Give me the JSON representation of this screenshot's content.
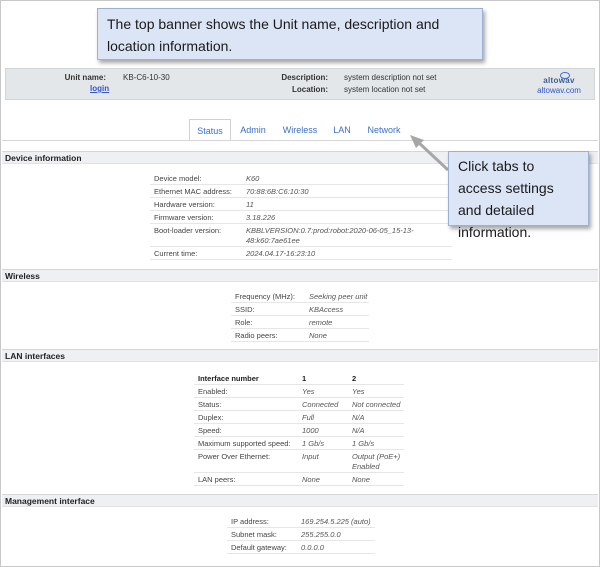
{
  "callouts": {
    "top": "The top banner shows the Unit name, description and location information.",
    "right": "Click tabs to access settings and detailed information."
  },
  "header": {
    "unit_name_label": "Unit name:",
    "unit_name_value": "KB-C6-10-30",
    "login_label": "login",
    "description_label": "Description:",
    "description_value": "system description not set",
    "location_label": "Location:",
    "location_value": "system location not set",
    "logo_text": "altowav",
    "logo_link": "altowav.com"
  },
  "tabs": [
    {
      "label": "Status",
      "active": true
    },
    {
      "label": "Admin",
      "active": false
    },
    {
      "label": "Wireless",
      "active": false
    },
    {
      "label": "LAN",
      "active": false
    },
    {
      "label": "Network",
      "active": false
    }
  ],
  "sections": {
    "device": "Device information",
    "wireless": "Wireless",
    "lan": "LAN interfaces",
    "mgmt": "Management interface"
  },
  "device_info": [
    {
      "label": "Device model:",
      "value": "K60"
    },
    {
      "label": "Ethernet MAC address:",
      "value": "70:88:6B:C6:10:30"
    },
    {
      "label": "Hardware version:",
      "value": "11"
    },
    {
      "label": "Firmware version:",
      "value": "3.18.226"
    },
    {
      "label": "Boot-loader version:",
      "value": "KBBLVERSION:0.7:prod:robot:2020-06-05_15-13-",
      "value2": "48:k60:7ae61ee"
    },
    {
      "label": "Current time:",
      "value": "2024.04.17-16:23:10"
    }
  ],
  "wireless": [
    {
      "label": "Frequency (MHz):",
      "value": "Seeking peer unit"
    },
    {
      "label": "SSID:",
      "value": "KBAccess"
    },
    {
      "label": "Role:",
      "value": "remote"
    },
    {
      "label": "Radio peers:",
      "value": "None"
    }
  ],
  "lan": {
    "header": {
      "label": "Interface number",
      "col1": "1",
      "col2": "2"
    },
    "rows": [
      {
        "label": "Enabled:",
        "v1": "Yes",
        "v2": "Yes"
      },
      {
        "label": "Status:",
        "v1": "Connected",
        "v2": "Not connected"
      },
      {
        "label": "Duplex:",
        "v1": "Full",
        "v2": "N/A"
      },
      {
        "label": "Speed:",
        "v1": "1000",
        "v2": "N/A"
      },
      {
        "label": "Maximum supported speed:",
        "v1": "1 Gb/s",
        "v2": "1 Gb/s"
      },
      {
        "label": "Power Over Ethernet:",
        "v1": "Input",
        "v2": "Output (PoE+)",
        "v2b": "Enabled"
      },
      {
        "label": "LAN peers:",
        "v1": "None",
        "v2": "None"
      }
    ]
  },
  "mgmt": [
    {
      "label": "IP address:",
      "value": "169.254.5.225 (auto)"
    },
    {
      "label": "Subnet mask:",
      "value": "255.255.0.0"
    },
    {
      "label": "Default gateway:",
      "value": "0.0.0.0"
    }
  ],
  "colors": {
    "accent": "#3b6fc8",
    "callout_bg": "#dbe5f5",
    "header_bg": "#e4e7ea"
  }
}
